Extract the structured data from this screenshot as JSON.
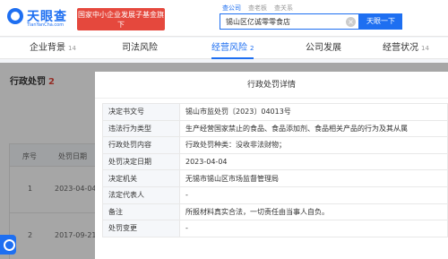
{
  "header": {
    "logo_text": "天眼查",
    "logo_domain": "TianYanCha.com",
    "banner_text": "国家中小企业发展子基金旗下",
    "search_tabs": [
      "查公司",
      "查老板",
      "查关系"
    ],
    "search_value": "锡山区亿诚零零食店",
    "search_button": "天眼一下",
    "clear_glyph": "×"
  },
  "nav": [
    {
      "label": "企业背景",
      "count": "14"
    },
    {
      "label": "司法风险",
      "count": ""
    },
    {
      "label": "经营风险",
      "count": "2"
    },
    {
      "label": "公司发展",
      "count": ""
    },
    {
      "label": "经营状况",
      "count": "14"
    }
  ],
  "section": {
    "title": "行政处罚",
    "count": "2",
    "columns": [
      "序号",
      "处罚日期"
    ],
    "rows": [
      {
        "index": "1",
        "date": "2023-04-04"
      },
      {
        "index": "2",
        "date": "2017-09-21"
      }
    ]
  },
  "modal": {
    "title": "行政处罚详情",
    "rows": [
      {
        "label": "决定书文号",
        "value": "锡山市监处罚〔2023〕04013号"
      },
      {
        "label": "违法行为类型",
        "value": "生产经营国家禁止的食品、食品添加剂、食品相关产品的行为及其从属"
      },
      {
        "label": "行政处罚内容",
        "value": "行政处罚种类：没收非法财物；"
      },
      {
        "label": "处罚决定日期",
        "value": "2023-04-04"
      },
      {
        "label": "决定机关",
        "value": "无锡市锡山区市场监督管理局"
      },
      {
        "label": "法定代表人",
        "value": "-"
      },
      {
        "label": "备注",
        "value": "所报材料真实合法，一切责任由当事人自负。"
      },
      {
        "label": "处罚变更",
        "value": "-"
      }
    ]
  },
  "colors": {
    "brand": "#1e6ff1",
    "banner": "#e5483d",
    "count_red": "#e5483d"
  }
}
